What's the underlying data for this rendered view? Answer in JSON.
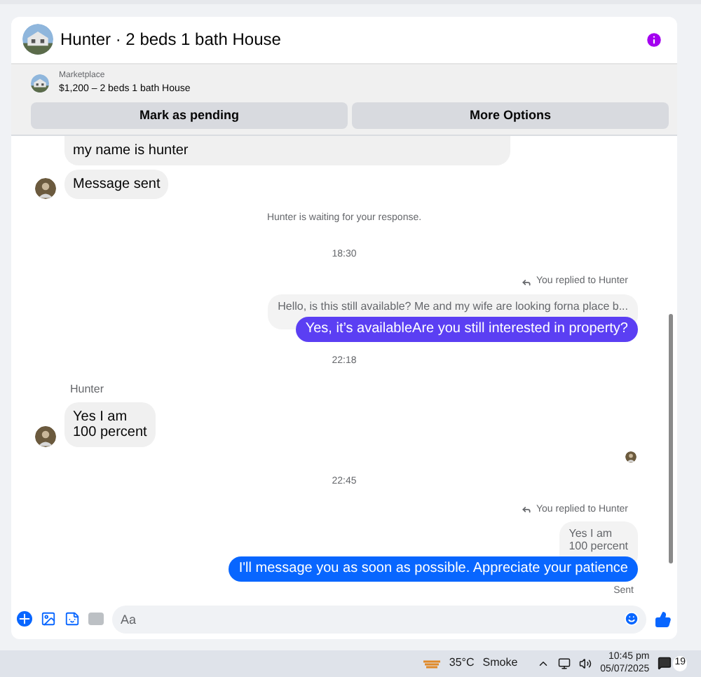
{
  "header": {
    "title": "Hunter · 2 beds 1 bath House"
  },
  "listing": {
    "source": "Marketplace",
    "title": "$1,200 – 2 beds 1 bath House"
  },
  "actions": [
    "Mark as pending",
    "More Options"
  ],
  "messages": [
    {
      "kind": "incoming",
      "lines": [
        "my name is hunter"
      ],
      "avatar": false
    },
    {
      "kind": "incoming",
      "lines": [
        "Message sent"
      ],
      "avatar": true
    },
    {
      "kind": "system",
      "text": "Hunter is waiting for your response."
    },
    {
      "kind": "time",
      "text": "18:30"
    },
    {
      "kind": "outgoing",
      "reply_label": "You replied to Hunter",
      "quote": [
        "Hello, is this still available? Me and my wife are looking forna place b..."
      ],
      "text": "Yes, it’s availableAre you still interested in property?",
      "color": "#5b3ff3"
    },
    {
      "kind": "time",
      "text": "22:18"
    },
    {
      "kind": "incoming",
      "sender": "Hunter",
      "lines": [
        "Yes I am",
        "100 percent"
      ],
      "avatar": true
    },
    {
      "kind": "seen"
    },
    {
      "kind": "time",
      "text": "22:45"
    },
    {
      "kind": "outgoing",
      "reply_label": "You replied to Hunter",
      "quote": [
        "Yes I am",
        "100 percent"
      ],
      "text": "I'll message you as soon as possible. Appreciate your patience",
      "color": "#0866ff",
      "status": "Sent"
    }
  ],
  "composer": {
    "placeholder": "Aa"
  },
  "taskbar": {
    "temperature": "35°C",
    "weather": "Smoke",
    "time": "10:45 pm",
    "date": "05/07/2025",
    "notifications": "19"
  }
}
